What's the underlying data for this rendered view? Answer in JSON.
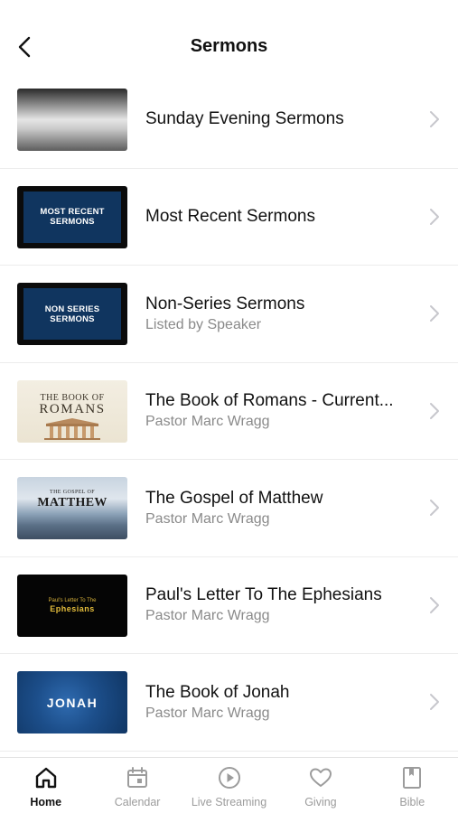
{
  "header": {
    "title": "Sermons",
    "back_icon": "chevron-left-icon"
  },
  "sermon_series": [
    {
      "title": "Sunday Evening Sermons",
      "subtitle": "",
      "thumbnail": "foggy-sea-image"
    },
    {
      "title": "Most Recent Sermons",
      "subtitle": "",
      "thumbnail": "most-recent-sermons-artwork",
      "thumbnail_text": "MOST RECENT SERMONS"
    },
    {
      "title": "Non-Series Sermons",
      "subtitle": "Listed by Speaker",
      "thumbnail": "non-series-sermons-artwork",
      "thumbnail_text": "NON SERIES SERMONS"
    },
    {
      "title": "The Book of Romans - Current...",
      "subtitle": "Pastor Marc Wragg",
      "thumbnail": "book-of-romans-artwork",
      "thumbnail_line1": "THE BOOK OF",
      "thumbnail_line2": "ROMANS"
    },
    {
      "title": "The Gospel of Matthew",
      "subtitle": "Pastor Marc Wragg",
      "thumbnail": "gospel-of-matthew-artwork",
      "thumbnail_line1": "THE GOSPEL OF",
      "thumbnail_line2": "MATTHEW"
    },
    {
      "title": "Paul's Letter To The Ephesians",
      "subtitle": "Pastor Marc Wragg",
      "thumbnail": "ephesians-artwork",
      "thumbnail_line1": "Paul's Letter To The",
      "thumbnail_line2": "Ephesians"
    },
    {
      "title": "The Book of Jonah",
      "subtitle": "Pastor Marc Wragg",
      "thumbnail": "jonah-artwork",
      "thumbnail_text": "JONAH"
    }
  ],
  "tab_bar": {
    "active": "Home",
    "tabs": [
      {
        "label": "Home",
        "icon": "home-icon"
      },
      {
        "label": "Calendar",
        "icon": "calendar-icon"
      },
      {
        "label": "Live Streaming",
        "icon": "play-circle-icon"
      },
      {
        "label": "Giving",
        "icon": "heart-icon"
      },
      {
        "label": "Bible",
        "icon": "book-icon"
      }
    ]
  },
  "colors": {
    "tab_inactive": "#9c9c9c",
    "tab_active": "#111111",
    "subtitle": "#8a8a8a",
    "chevron": "#c7c7cc"
  }
}
